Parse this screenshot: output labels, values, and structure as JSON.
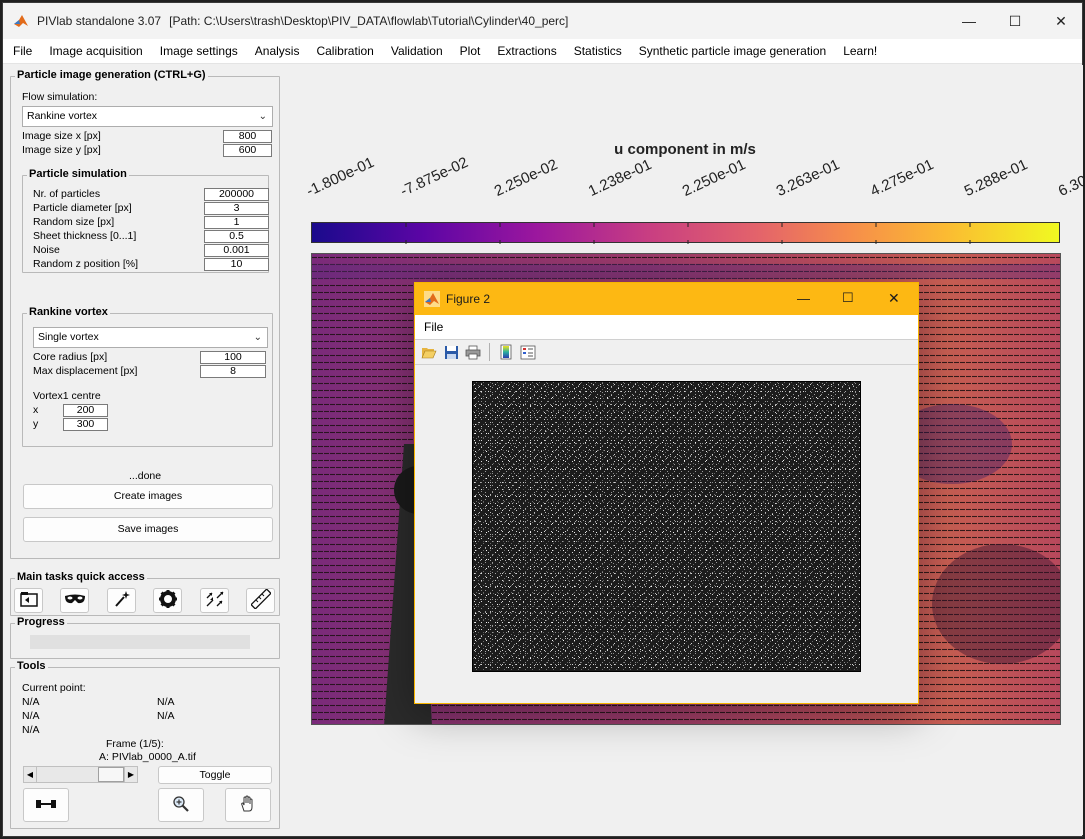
{
  "window": {
    "app_title": "PIVlab standalone 3.07",
    "path": "[Path: C:\\Users\\trash\\Desktop\\PIV_DATA\\flowlab\\Tutorial\\Cylinder\\40_perc]",
    "minimize": "—",
    "maximize": "☐",
    "close": "✕"
  },
  "menu": [
    "File",
    "Image acquisition",
    "Image settings",
    "Analysis",
    "Calibration",
    "Validation",
    "Plot",
    "Extractions",
    "Statistics",
    "Synthetic particle image generation",
    "Learn!"
  ],
  "gen_panel": {
    "title": "Particle image generation (CTRL+G)",
    "flow_label": "Flow simulation:",
    "flow_value": "Rankine vortex",
    "size_x_label": "Image size x [px]",
    "size_x": "800",
    "size_y_label": "Image size y [px]",
    "size_y": "600"
  },
  "particle_sim": {
    "title": "Particle simulation",
    "rows": [
      {
        "label": "Nr. of particles",
        "value": "200000"
      },
      {
        "label": "Particle diameter [px]",
        "value": "3"
      },
      {
        "label": "Random size [px]",
        "value": "1"
      },
      {
        "label": "Sheet thickness [0...1]",
        "value": "0.5"
      },
      {
        "label": "Noise",
        "value": "0.001"
      },
      {
        "label": "Random z position [%]",
        "value": "10"
      }
    ]
  },
  "rankine": {
    "title": "Rankine vortex",
    "mode": "Single vortex",
    "core_label": "Core radius [px]",
    "core": "100",
    "disp_label": "Max displacement [px]",
    "disp": "8",
    "centre_label": "Vortex1 centre",
    "x_label": "x",
    "x": "200",
    "y_label": "y",
    "y": "300"
  },
  "actions": {
    "status": "...done",
    "create": "Create images",
    "save": "Save images"
  },
  "quick": {
    "title": "Main tasks quick access"
  },
  "progress": {
    "title": "Progress",
    "value": 0
  },
  "tools": {
    "title": "Tools",
    "current_point": "Current point:",
    "na": "N/A",
    "frame": "Frame (1/5):",
    "file": "A: PIVlab_0000_A.tif",
    "toggle": "Toggle"
  },
  "colorbar": {
    "title": "u component in m/s",
    "ticks": [
      "-1.800e-01",
      "-7.875e-02",
      "2.250e-02",
      "1.238e-01",
      "2.250e-01",
      "3.263e-01",
      "4.275e-01",
      "5.288e-01",
      "6.30"
    ]
  },
  "figure2": {
    "title": "Figure 2",
    "menu_file": "File"
  },
  "colors": {
    "figure_titlebar": "#fdb813",
    "accent": "#0078d4"
  }
}
